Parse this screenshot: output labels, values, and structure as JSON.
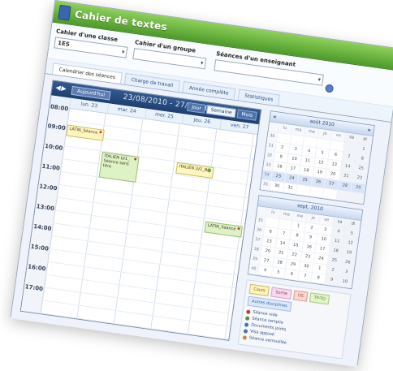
{
  "window": {
    "title": "Cahier de textes"
  },
  "filters": {
    "class_label": "Cahier d'une classe",
    "class_value": "1ES",
    "group_label": "Cahier d'un groupe",
    "group_value": "",
    "teacher_label": "Séances d'un enseignant",
    "teacher_value": ""
  },
  "tabs": [
    {
      "label": "Calendrier des séances"
    },
    {
      "label": "Charge de travail"
    },
    {
      "label": "Année complète"
    },
    {
      "label": "Statistiques"
    }
  ],
  "calendar": {
    "today_label": "Aujourd'hui",
    "range_label": "23/08/2010 - 27/08/2010",
    "views": [
      "Jour",
      "Semaine",
      "Mois"
    ],
    "days": [
      "lun. 23",
      "mar. 24",
      "mer. 25",
      "jeu. 26",
      "ven. 27"
    ],
    "hours": [
      "08:00",
      "09:00",
      "10:00",
      "11:00",
      "12:00",
      "13:00",
      "14:00",
      "15:00",
      "16:00",
      "17:00"
    ],
    "events": [
      {
        "text": "LATIN_Séance",
        "variant": "yellow",
        "marker": "dot"
      },
      {
        "text": "ITALIEN LV1_ Séance sans titre",
        "variant": "green",
        "marker": "dot"
      },
      {
        "text": "ITALIEN LV1_B",
        "variant": "yellow",
        "marker": "gear"
      },
      {
        "text": "LATIN_Séance",
        "variant": "green",
        "marker": "dot"
      }
    ]
  },
  "mini_calendars": [
    {
      "title": "août 2010",
      "headers": [
        "",
        "lu",
        "ma",
        "me",
        "je",
        "ve",
        "sa",
        "di"
      ],
      "rows": [
        [
          "30",
          "",
          "",
          "",
          "",
          "",
          "",
          "1"
        ],
        [
          "31",
          "2",
          "3",
          "4",
          "5",
          "6",
          "7",
          "8"
        ],
        [
          "32",
          "9",
          "10",
          "11",
          "12",
          "13",
          "14",
          "15"
        ],
        [
          "33",
          "16",
          "17",
          "18",
          "19",
          "20",
          "21",
          "22"
        ],
        [
          "34",
          "23",
          "24",
          "25",
          "26",
          "27",
          "28",
          "29"
        ],
        [
          "35",
          "30",
          "31",
          "",
          "",
          "",
          "",
          ""
        ]
      ]
    },
    {
      "title": "sept. 2010",
      "headers": [
        "",
        "lu",
        "ma",
        "me",
        "je",
        "ve",
        "sa",
        "di"
      ],
      "rows": [
        [
          "35",
          "",
          "",
          "1",
          "2",
          "3",
          "4",
          "5"
        ],
        [
          "36",
          "6",
          "7",
          "8",
          "9",
          "10",
          "11",
          "12"
        ],
        [
          "37",
          "13",
          "14",
          "15",
          "16",
          "17",
          "18",
          "19"
        ],
        [
          "38",
          "20",
          "21",
          "22",
          "23",
          "24",
          "25",
          "26"
        ],
        [
          "39",
          "27",
          "28",
          "29",
          "30",
          "1",
          "2",
          "3"
        ],
        [
          "40",
          "4",
          "5",
          "6",
          "7",
          "8",
          "9",
          "10"
        ]
      ]
    }
  ],
  "legend": {
    "tags": [
      {
        "label": "Cours",
        "style": "yellow"
      },
      {
        "label": "Sortie",
        "style": "pink"
      },
      {
        "label": "DS",
        "style": "red"
      },
      {
        "label": "TP-TD",
        "style": "green"
      },
      {
        "label": "Autres disciplines",
        "style": "blue"
      }
    ],
    "items": [
      {
        "label": "Séance vide",
        "color": "#c53e37"
      },
      {
        "label": "Séance remplie",
        "color": "#5b8e43"
      },
      {
        "label": "Documents joints",
        "color": "#4d71b6"
      },
      {
        "label": "Visa apposé",
        "color": "#4d71b6"
      },
      {
        "label": "Séance verrouillée",
        "color": "#c48a3e"
      }
    ]
  }
}
